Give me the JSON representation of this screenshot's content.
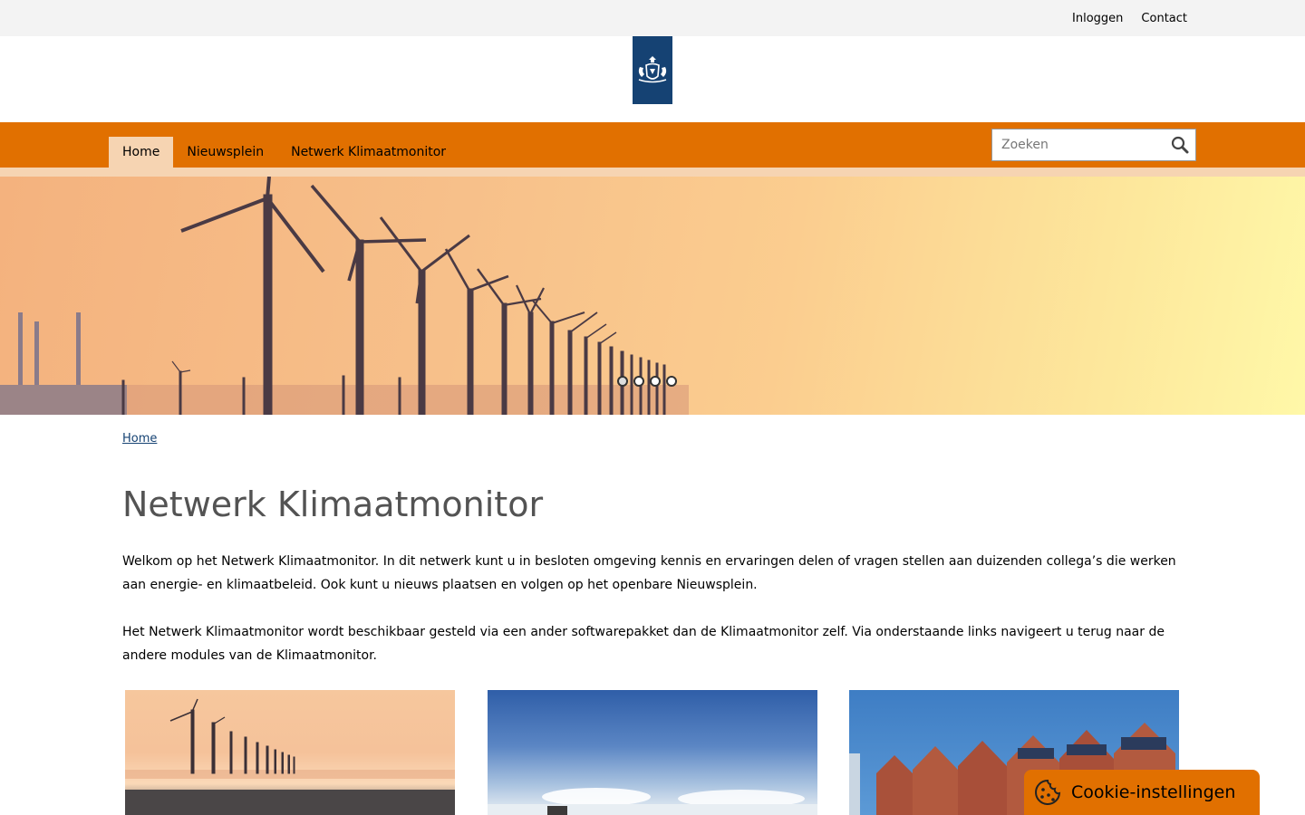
{
  "topbar": {
    "login": "Inloggen",
    "contact": "Contact"
  },
  "nav": {
    "items": [
      "Home",
      "Nieuwsplein",
      "Netwerk Klimaatmonitor"
    ],
    "active": "Home"
  },
  "search": {
    "placeholder": "Zoeken"
  },
  "hero": {
    "slides": 4,
    "active_slide": 1
  },
  "breadcrumb": {
    "home": "Home"
  },
  "main": {
    "title": "Netwerk Klimaatmonitor",
    "paragraph1": "Welkom op het Netwerk Klimaatmonitor. In dit netwerk kunt u in besloten omgeving kennis en ervaringen delen of vragen stellen aan duizenden collega’s die werken aan energie- en klimaatbeleid. Ook kunt u nieuws plaatsen en volgen op het openbare Nieuwsplein.",
    "paragraph2": "Het Netwerk Klimaatmonitor wordt beschikbaar gesteld via een ander softwarepakket dan de Klimaatmonitor zelf. Via onderstaande links navigeert u terug naar de andere modules van de Klimaatmonitor."
  },
  "cookie": {
    "label": "Cookie-instellingen"
  },
  "colors": {
    "brand_orange": "#e17000",
    "logo_blue": "#154273",
    "nav_active": "#f6d4b2"
  },
  "icons": [
    "rijksoverheid-logo",
    "search-icon",
    "cookie-icon"
  ]
}
